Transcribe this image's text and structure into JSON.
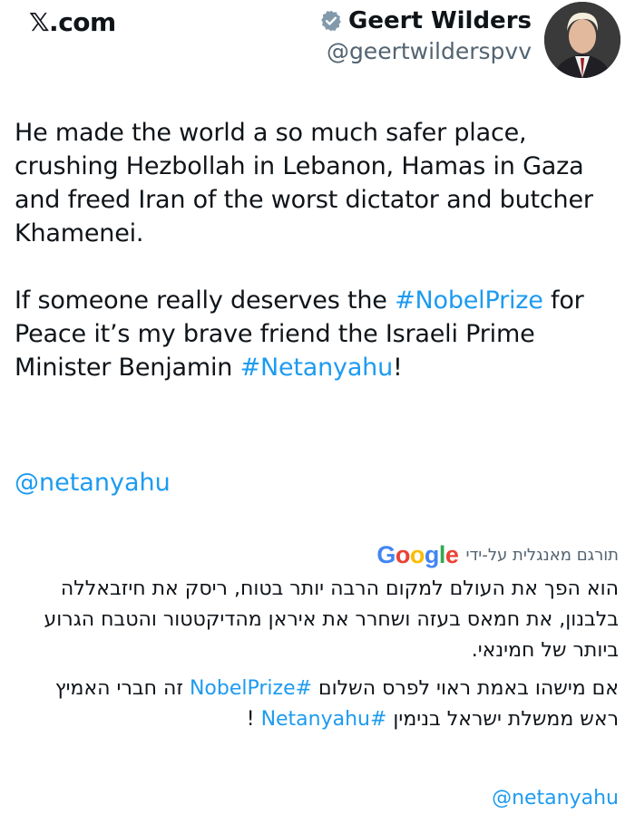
{
  "header": {
    "brand": "𝕏.com",
    "author_name": "Geert Wilders",
    "handle": "@geertwilderspvv"
  },
  "tweet": {
    "para1": "He made the world a so much safer place, crushing Hezbollah in Lebanon, Hamas in Gaza and freed Iran of the worst dictator and butcher Khamenei.",
    "para2_a": "If someone really deserves the ",
    "hashtag1": "#NobelPrize",
    "para2_b": " for Peace it’s my brave friend the Israeli Prime Minister Benjamin ",
    "hashtag2": "#Netanyahu",
    "para2_c": "!",
    "mention": "@netanyahu"
  },
  "translation": {
    "label": "תורגם מאנגלית על-ידי",
    "logo": "Google",
    "para1": "הוא הפך את העולם למקום הרבה יותר בטוח, ריסק את חיזבאללה בלבנון, את חמאס בעזה ושחרר את איראן מהדיקטטור והטבח הגרוע ביותר של חמינאי.",
    "para2_a": "אם מישהו באמת ראוי לפרס השלום ",
    "hashtag1": "#NobelPrize",
    "para2_b": " זה חברי האמיץ ראש ממשלת ישראל בנימין ",
    "hashtag2": "#Netanyahu",
    "para2_c": " !",
    "mention": "@netanyahu"
  },
  "colors": {
    "link": "#1d9bf0",
    "muted": "#536471",
    "text": "#0f1419",
    "google": [
      "#4285F4",
      "#EA4335",
      "#FBBC05",
      "#4285F4",
      "#34A853",
      "#EA4335"
    ]
  }
}
